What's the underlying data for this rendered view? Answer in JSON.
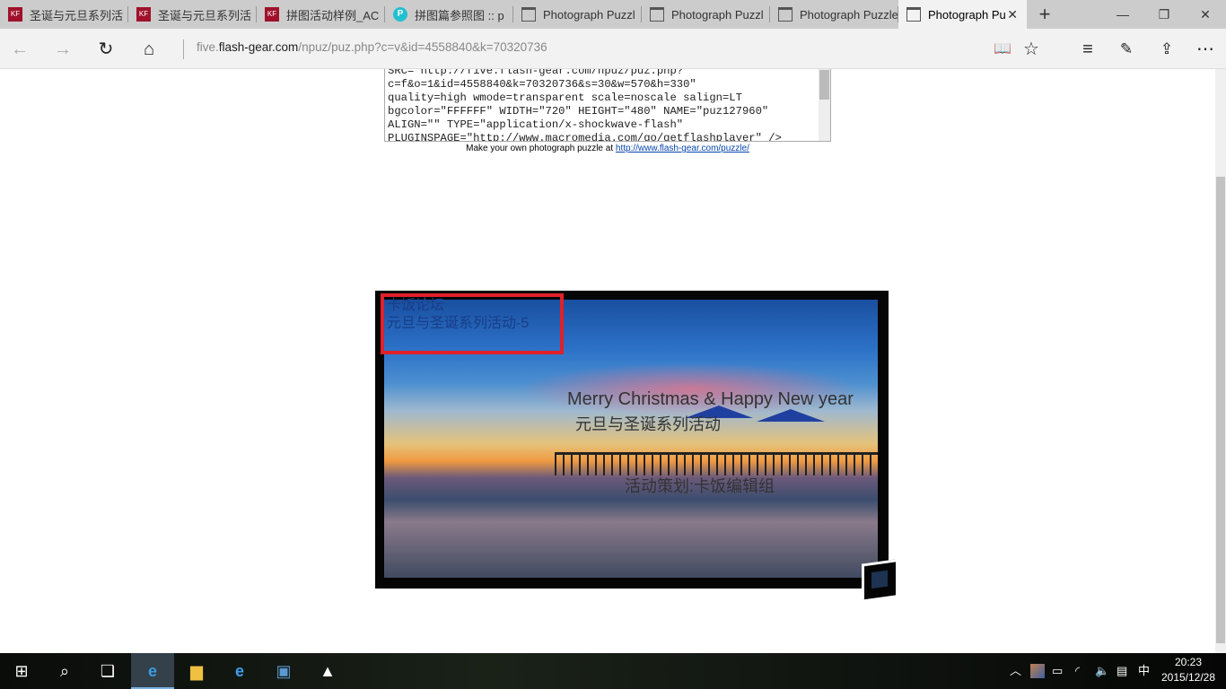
{
  "browser": {
    "tabs": [
      {
        "label": "圣诞与元旦系列活",
        "icon": "site-logo-icon"
      },
      {
        "label": "圣诞与元旦系列活",
        "icon": "site-logo-icon"
      },
      {
        "label": "拼图活动样例_AC",
        "icon": "site-logo-icon"
      },
      {
        "label": "拼图篇参照图 :: p",
        "icon": "p-logo-icon"
      },
      {
        "label": "Photograph Puzzl",
        "icon": "page-icon"
      },
      {
        "label": "Photograph Puzzl",
        "icon": "page-icon"
      },
      {
        "label": "Photograph Puzzle",
        "icon": "page-icon"
      },
      {
        "label": "Photograph Pu",
        "icon": "page-icon",
        "active": true
      }
    ],
    "url_domain_prefix": "five.",
    "url_domain": "flash-gear.com",
    "url_path": "/npuz/puz.php?c=v&id=4558840&k=70320736"
  },
  "page": {
    "embed_code": "SRC=\"http://five.flash-gear.com/npuz/puz.php?\nc=f&o=1&id=4558840&k=70320736&s=30&w=570&h=330\"\nquality=high wmode=transparent scale=noscale salign=LT\nbgcolor=\"FFFFFF\" WIDTH=\"720\" HEIGHT=\"480\" NAME=\"puz127960\"\nALIGN=\"\" TYPE=\"application/x-shockwave-flash\"\nPLUGINSPAGE=\"http://www.macromedia.com/go/getflashplayer\" />",
    "credit_text": "Make your own photograph puzzle at ",
    "credit_link": "http://www.flash-gear.com/puzzle/",
    "puzzle": {
      "line1": "Merry Christmas & Happy New year",
      "line2": "元旦与圣诞系列活动",
      "line3": "活动策划:卡饭编辑组",
      "corner_line1": "卡饭论坛",
      "corner_line2": "元旦与圣诞系列活动-5",
      "highlight_color": "#e0202a"
    }
  },
  "taskbar": {
    "time": "20:23",
    "date": "2015/12/28",
    "ime": "中"
  }
}
